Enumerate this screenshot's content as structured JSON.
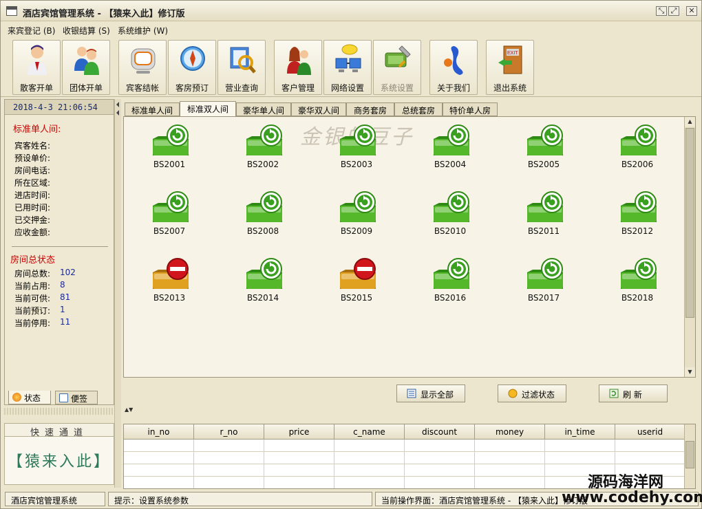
{
  "window": {
    "title": "酒店宾馆管理系统 - 【猿来入此】修订版",
    "btn_restore": "⤡",
    "btn_max": "⤢",
    "btn_close": "✕"
  },
  "menu": [
    "来宾登记 (B)",
    "收银结算 (S)",
    "系统维护 (W)"
  ],
  "toolbar": [
    {
      "label": "散客开单",
      "icon": "single-guest-icon"
    },
    {
      "label": "团体开单",
      "icon": "group-guest-icon"
    },
    {
      "label": "宾客结帐",
      "icon": "checkout-icon"
    },
    {
      "label": "客房预订",
      "icon": "booking-compass-icon"
    },
    {
      "label": "营业查询",
      "icon": "search-magnifier-icon"
    },
    {
      "label": "客户管理",
      "icon": "customer-icon"
    },
    {
      "label": "网络设置",
      "icon": "network-icon"
    },
    {
      "label": "系统设置",
      "icon": "settings-icon",
      "disabled": true
    },
    {
      "label": "关于我们",
      "icon": "about-icon"
    },
    {
      "label": "退出系统",
      "icon": "exit-door-icon"
    }
  ],
  "left": {
    "datetime": "2018-4-3  21:06:54",
    "room_title": "标准单人间:",
    "fields": [
      "宾客姓名:",
      "预设单价:",
      "房间电话:",
      "所在区域:",
      "进店时间:",
      "已用时间:",
      "已交押金:",
      "应收金额:"
    ],
    "status_title": "房间总状态",
    "stats": [
      {
        "k": "房间总数:",
        "v": "102"
      },
      {
        "k": "当前占用:",
        "v": "8"
      },
      {
        "k": "当前可供:",
        "v": "81"
      },
      {
        "k": "当前预订:",
        "v": "1"
      },
      {
        "k": "当前停用:",
        "v": "11"
      }
    ],
    "tab_status": "状态",
    "tab_note": "便签",
    "quick_title": "快速通道",
    "quick_logo": "【猿来入此】"
  },
  "room_tabs": [
    "标准单人间",
    "标准双人间",
    "豪华单人间",
    "豪华双人间",
    "商务套房",
    "总统套房",
    "特价单人房"
  ],
  "active_tab": 1,
  "watermark": "金银的豆子",
  "rooms": [
    {
      "id": "BS2001",
      "state": "available"
    },
    {
      "id": "BS2002",
      "state": "available"
    },
    {
      "id": "BS2003",
      "state": "available"
    },
    {
      "id": "BS2004",
      "state": "available"
    },
    {
      "id": "BS2005",
      "state": "available"
    },
    {
      "id": "BS2006",
      "state": "available"
    },
    {
      "id": "BS2007",
      "state": "available"
    },
    {
      "id": "BS2008",
      "state": "available"
    },
    {
      "id": "BS2009",
      "state": "available"
    },
    {
      "id": "BS2010",
      "state": "available"
    },
    {
      "id": "BS2011",
      "state": "available"
    },
    {
      "id": "BS2012",
      "state": "available"
    },
    {
      "id": "BS2013",
      "state": "disabled"
    },
    {
      "id": "BS2014",
      "state": "available"
    },
    {
      "id": "BS2015",
      "state": "disabled"
    },
    {
      "id": "BS2016",
      "state": "available"
    },
    {
      "id": "BS2017",
      "state": "available"
    },
    {
      "id": "BS2018",
      "state": "available"
    }
  ],
  "buttons": {
    "show_all": "显示全部",
    "filter": "过滤状态",
    "refresh": "刷  新"
  },
  "grid_columns": [
    "in_no",
    "r_no",
    "price",
    "c_name",
    "discount",
    "money",
    "in_time",
    "userid"
  ],
  "status": {
    "app": "酒店宾馆管理系统",
    "hint": "提示：设置系统参数",
    "current": "当前操作界面：酒店宾馆管理系统 - 【猿来入此】修订版"
  },
  "site_mark": {
    "cn": "源码海洋网",
    "en": "www.codehy.com"
  },
  "colors": {
    "available": "#55b82a",
    "disabled": "#e0a020",
    "stop": "#d0161c",
    "accent_red": "#cc0000"
  }
}
